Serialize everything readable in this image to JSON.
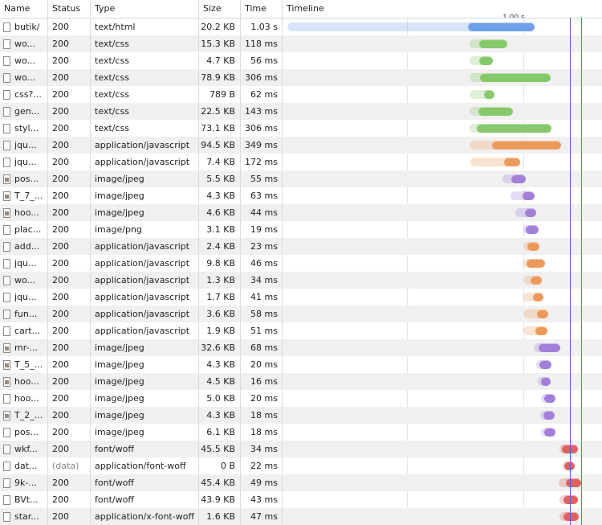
{
  "columns": {
    "name": "Name",
    "status": "Status",
    "type": "Type",
    "size": "Size",
    "time": "Time",
    "timeline": "Timeline"
  },
  "timeline": {
    "tick_label": "1.00 s",
    "blue_line_color": "#5b5bd6",
    "red_line_color": "#e05050"
  },
  "colors": {
    "html": "#6f9fe8",
    "css": "#86c96b",
    "js": "#ec9a5c",
    "image": "#a27fd8",
    "font": "#e06060"
  },
  "requests": [
    {
      "name": "butik/",
      "status": "200",
      "type": "text/html",
      "size": "20.2 KB",
      "time": "1.03 s",
      "kind": "html",
      "icon": "doc-icon"
    },
    {
      "name": "wo...",
      "status": "200",
      "type": "text/css",
      "size": "15.3 KB",
      "time": "118 ms",
      "kind": "css",
      "icon": "doc-icon"
    },
    {
      "name": "wo...",
      "status": "200",
      "type": "text/css",
      "size": "4.7 KB",
      "time": "56 ms",
      "kind": "css",
      "icon": "doc-icon"
    },
    {
      "name": "wo...",
      "status": "200",
      "type": "text/css",
      "size": "78.9 KB",
      "time": "306 ms",
      "kind": "css",
      "icon": "doc-icon"
    },
    {
      "name": "css?...",
      "status": "200",
      "type": "text/css",
      "size": "789 B",
      "time": "62 ms",
      "kind": "css",
      "icon": "doc-icon"
    },
    {
      "name": "gen...",
      "status": "200",
      "type": "text/css",
      "size": "22.5 KB",
      "time": "143 ms",
      "kind": "css",
      "icon": "doc-icon"
    },
    {
      "name": "styl...",
      "status": "200",
      "type": "text/css",
      "size": "73.1 KB",
      "time": "306 ms",
      "kind": "css",
      "icon": "doc-icon"
    },
    {
      "name": "jqu...",
      "status": "200",
      "type": "application/javascript",
      "size": "94.5 KB",
      "time": "349 ms",
      "kind": "js",
      "icon": "doc-icon"
    },
    {
      "name": "jqu...",
      "status": "200",
      "type": "application/javascript",
      "size": "7.4 KB",
      "time": "172 ms",
      "kind": "js",
      "icon": "doc-icon"
    },
    {
      "name": "pos...",
      "status": "200",
      "type": "image/jpeg",
      "size": "5.5 KB",
      "time": "55 ms",
      "kind": "image",
      "icon": "image-thumb-icon"
    },
    {
      "name": "T_7_...",
      "status": "200",
      "type": "image/jpeg",
      "size": "4.3 KB",
      "time": "63 ms",
      "kind": "image",
      "icon": "image-thumb-icon"
    },
    {
      "name": "hoo...",
      "status": "200",
      "type": "image/jpeg",
      "size": "4.6 KB",
      "time": "44 ms",
      "kind": "image",
      "icon": "image-thumb-icon"
    },
    {
      "name": "plac...",
      "status": "200",
      "type": "image/png",
      "size": "3.1 KB",
      "time": "19 ms",
      "kind": "image",
      "icon": "doc-icon"
    },
    {
      "name": "add...",
      "status": "200",
      "type": "application/javascript",
      "size": "2.4 KB",
      "time": "23 ms",
      "kind": "js",
      "icon": "doc-icon"
    },
    {
      "name": "jqu...",
      "status": "200",
      "type": "application/javascript",
      "size": "9.8 KB",
      "time": "46 ms",
      "kind": "js",
      "icon": "doc-icon"
    },
    {
      "name": "wo...",
      "status": "200",
      "type": "application/javascript",
      "size": "1.3 KB",
      "time": "34 ms",
      "kind": "js",
      "icon": "doc-icon"
    },
    {
      "name": "jqu...",
      "status": "200",
      "type": "application/javascript",
      "size": "1.7 KB",
      "time": "41 ms",
      "kind": "js",
      "icon": "doc-icon"
    },
    {
      "name": "fun...",
      "status": "200",
      "type": "application/javascript",
      "size": "3.6 KB",
      "time": "58 ms",
      "kind": "js",
      "icon": "doc-icon"
    },
    {
      "name": "cart...",
      "status": "200",
      "type": "application/javascript",
      "size": "1.9 KB",
      "time": "51 ms",
      "kind": "js",
      "icon": "doc-icon"
    },
    {
      "name": "mr-...",
      "status": "200",
      "type": "image/jpeg",
      "size": "32.6 KB",
      "time": "68 ms",
      "kind": "image",
      "icon": "image-thumb-icon"
    },
    {
      "name": "T_5_...",
      "status": "200",
      "type": "image/jpeg",
      "size": "4.3 KB",
      "time": "20 ms",
      "kind": "image",
      "icon": "image-thumb-icon"
    },
    {
      "name": "hoo...",
      "status": "200",
      "type": "image/jpeg",
      "size": "4.5 KB",
      "time": "16 ms",
      "kind": "image",
      "icon": "image-thumb-icon"
    },
    {
      "name": "hoo...",
      "status": "200",
      "type": "image/jpeg",
      "size": "5.0 KB",
      "time": "20 ms",
      "kind": "image",
      "icon": "doc-icon"
    },
    {
      "name": "T_2_...",
      "status": "200",
      "type": "image/jpeg",
      "size": "4.3 KB",
      "time": "18 ms",
      "kind": "image",
      "icon": "image-thumb-icon"
    },
    {
      "name": "pos...",
      "status": "200",
      "type": "image/jpeg",
      "size": "6.1 KB",
      "time": "18 ms",
      "kind": "image",
      "icon": "doc-icon"
    },
    {
      "name": "wkf...",
      "status": "200",
      "type": "font/woff",
      "size": "45.5 KB",
      "time": "34 ms",
      "kind": "font",
      "icon": "doc-icon"
    },
    {
      "name": "dat...",
      "status": "(data)",
      "type": "application/font-woff",
      "size": "0 B",
      "time": "22 ms",
      "kind": "font",
      "icon": "doc-icon"
    },
    {
      "name": "9k-...",
      "status": "200",
      "type": "font/woff",
      "size": "45.4 KB",
      "time": "49 ms",
      "kind": "font",
      "icon": "doc-icon"
    },
    {
      "name": "BVt...",
      "status": "200",
      "type": "font/woff",
      "size": "43.9 KB",
      "time": "43 ms",
      "kind": "font",
      "icon": "doc-icon"
    },
    {
      "name": "star...",
      "status": "200",
      "type": "application/x-font-woff",
      "size": "1.6 KB",
      "time": "47 ms",
      "kind": "font",
      "icon": "doc-icon"
    }
  ]
}
